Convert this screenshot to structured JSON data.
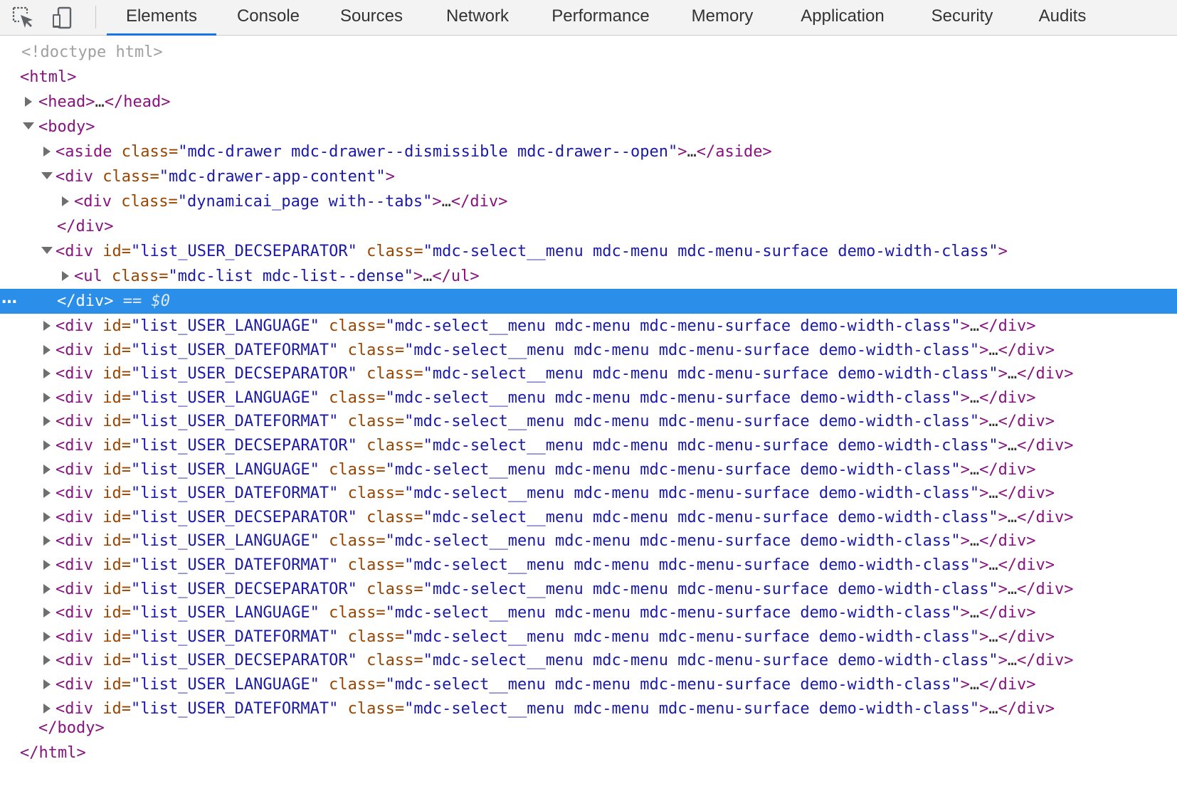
{
  "toolbar": {
    "tabs": [
      {
        "label": "Elements"
      },
      {
        "label": "Console"
      },
      {
        "label": "Sources"
      },
      {
        "label": "Network"
      },
      {
        "label": "Performance"
      },
      {
        "label": "Memory"
      },
      {
        "label": "Application"
      },
      {
        "label": "Security"
      },
      {
        "label": "Audits"
      }
    ],
    "active_tab": "Elements",
    "icons": [
      "inspect-element-icon",
      "device-toolbar-icon"
    ]
  },
  "colors": {
    "accent": "#1a73e8",
    "selection": "#2b8ee8",
    "tag": "#881280",
    "attr_name": "#994500",
    "attr_value": "#1a1aa6"
  },
  "tree": {
    "doctype": "<!doctype html>",
    "html_open": "<html>",
    "html_close": "</html>",
    "head": {
      "open": "<head>",
      "ellipsis": "…",
      "close": "</head>"
    },
    "body_open": "<body>",
    "body_close": "</body>",
    "aside": {
      "tag": "<aside",
      "attr": "class",
      "value": "\"mdc-drawer mdc-drawer--dismissible mdc-drawer--open\"",
      "tail": ">",
      "ellipsis": "…",
      "close": "</aside>"
    },
    "app_content": {
      "tag": "<div",
      "attr": "class",
      "value": "\"mdc-drawer-app-content\"",
      "tail": ">",
      "close": "</div>"
    },
    "page_div": {
      "tag": "<div",
      "attr": "class",
      "value": "\"dynamicai_page with--tabs\"",
      "tail": ">",
      "ellipsis": "…",
      "close": "</div>"
    },
    "open_menu": {
      "tag": "<div",
      "id_attr": "id",
      "id_value": "\"list_USER_DECSEPARATOR\"",
      "class_attr": "class",
      "class_value": "\"mdc-select__menu mdc-menu mdc-menu-surface demo-width-class\"",
      "tail": ">"
    },
    "ul": {
      "tag": "<ul",
      "attr": "class",
      "value": "\"mdc-list mdc-list--dense\"",
      "tail": ">",
      "ellipsis": "…",
      "close": "</ul>"
    },
    "selected_close": {
      "close": "</div>",
      "suffix": "== $0",
      "dots": "…"
    },
    "menu_rows": [
      {
        "id_value": "\"list_USER_LANGUAGE\""
      },
      {
        "id_value": "\"list_USER_DATEFORMAT\""
      },
      {
        "id_value": "\"list_USER_DECSEPARATOR\""
      },
      {
        "id_value": "\"list_USER_LANGUAGE\""
      },
      {
        "id_value": "\"list_USER_DATEFORMAT\""
      },
      {
        "id_value": "\"list_USER_DECSEPARATOR\""
      },
      {
        "id_value": "\"list_USER_LANGUAGE\""
      },
      {
        "id_value": "\"list_USER_DATEFORMAT\""
      },
      {
        "id_value": "\"list_USER_DECSEPARATOR\""
      },
      {
        "id_value": "\"list_USER_LANGUAGE\""
      },
      {
        "id_value": "\"list_USER_DATEFORMAT\""
      },
      {
        "id_value": "\"list_USER_DECSEPARATOR\""
      },
      {
        "id_value": "\"list_USER_LANGUAGE\""
      },
      {
        "id_value": "\"list_USER_DATEFORMAT\""
      },
      {
        "id_value": "\"list_USER_DECSEPARATOR\""
      },
      {
        "id_value": "\"list_USER_LANGUAGE\""
      },
      {
        "id_value": "\"list_USER_DATEFORMAT\""
      }
    ],
    "menu_row_common": {
      "tag": "<div",
      "id_attr": "id",
      "class_attr": "class",
      "class_value": "\"mdc-select__menu mdc-menu mdc-menu-surface demo-width-class\"",
      "tail": ">",
      "ellipsis": "…",
      "close": "</div>"
    }
  }
}
